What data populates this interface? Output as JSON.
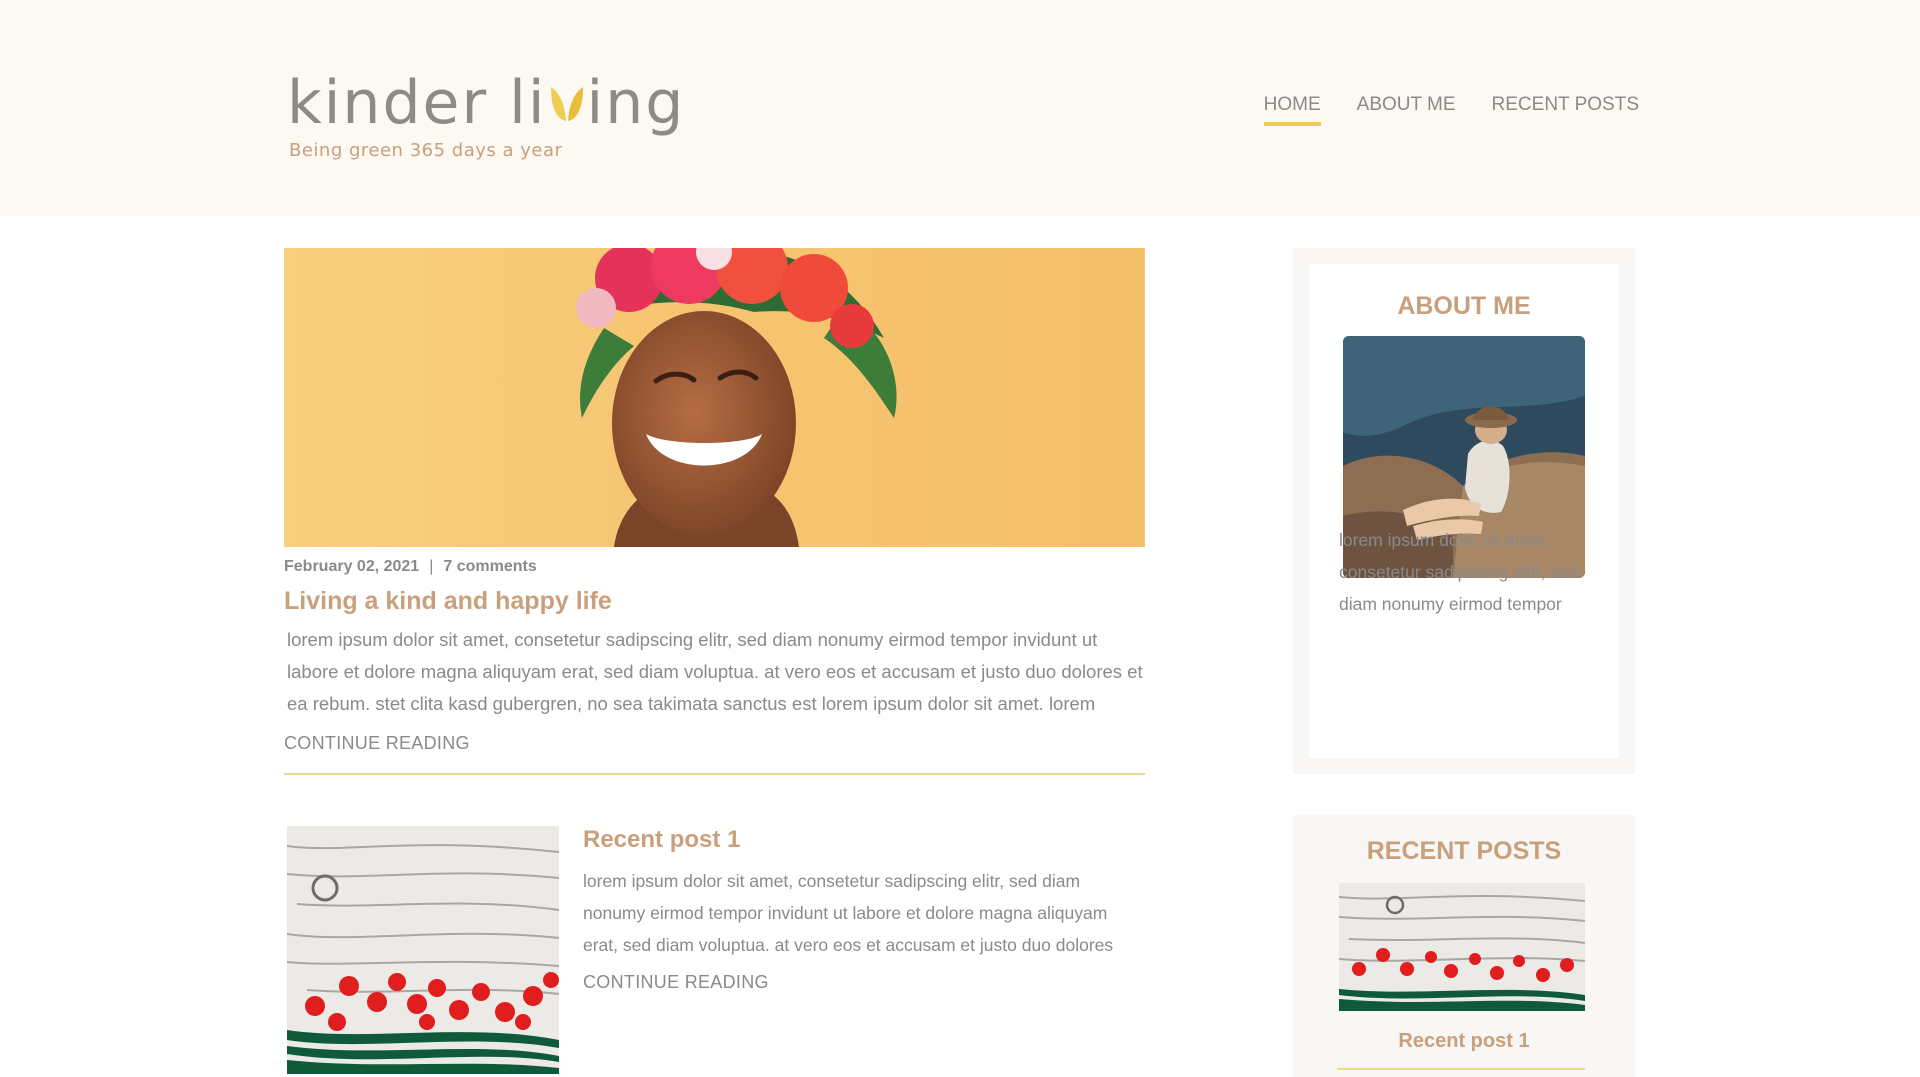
{
  "header": {
    "logo_text_1": "kinder li",
    "logo_text_2": "ing",
    "tagline": "Being green 365 days a year",
    "nav": [
      {
        "label": "HOME",
        "active": true
      },
      {
        "label": "ABOUT ME",
        "active": false
      },
      {
        "label": "RECENT POSTS",
        "active": false
      }
    ]
  },
  "featured_post": {
    "date": "February 02, 2021",
    "separator": "|",
    "comments": "7 comments",
    "title": "Living a kind and happy life",
    "excerpt": "lorem ipsum dolor sit amet, consetetur sadipscing elitr, sed diam nonumy eirmod tempor invidunt ut labore et dolore magna aliquyam erat, sed diam voluptua. at vero eos et accusam et justo duo dolores et ea rebum. stet clita kasd gubergren, no sea takimata sanctus est lorem ipsum dolor sit amet. lorem",
    "continue_label": "CONTINUE READING"
  },
  "recent_post": {
    "title": "Recent post 1",
    "excerpt": "lorem ipsum dolor sit amet, consetetur sadipscing elitr, sed diam nonumy eirmod tempor invidunt ut labore et dolore magna aliquyam erat, sed diam voluptua. at vero eos et accusam et justo duo dolores",
    "continue_label": "CONTINUE READING"
  },
  "sidebar": {
    "about": {
      "heading": "ABOUT ME",
      "text": "lorem ipsum dolor sit amet, consetetur sadipscing elitr, sed diam nonumy eirmod tempor"
    },
    "recent": {
      "heading": "RECENT POSTS",
      "items": [
        {
          "title": "Recent post 1"
        }
      ]
    }
  },
  "colors": {
    "header_bg": "#fcf9f2",
    "accent_gold": "#efcc58",
    "title_tan": "#c9a07c",
    "text_gray": "#8a8a8a"
  }
}
